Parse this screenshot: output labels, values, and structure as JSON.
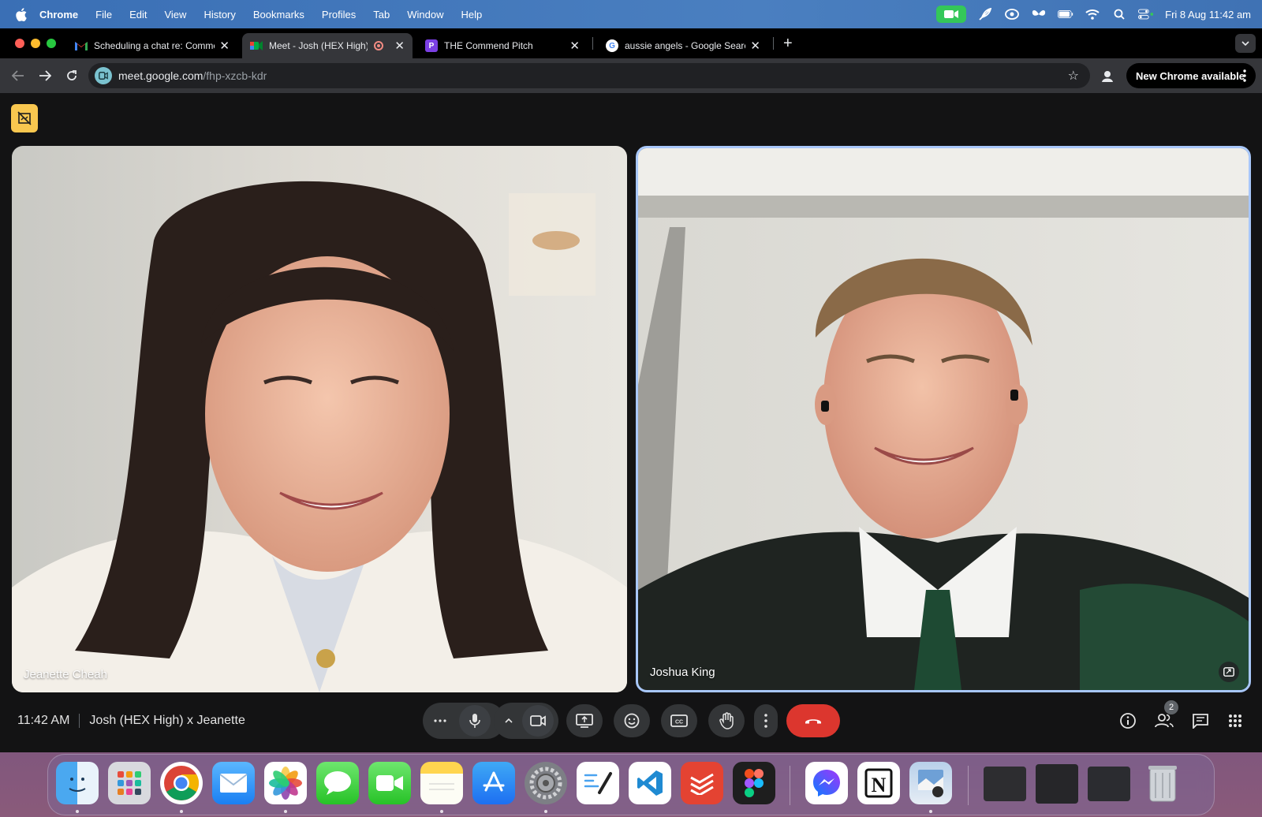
{
  "menubar": {
    "app_name": "Chrome",
    "items": [
      "File",
      "Edit",
      "View",
      "History",
      "Bookmarks",
      "Profiles",
      "Tab",
      "Window",
      "Help"
    ],
    "clock": "Fri 8 Aug  11:42 am"
  },
  "tabs": [
    {
      "title": "Scheduling a chat re: Comme",
      "icon": "gmail-icon",
      "active": false
    },
    {
      "title": "Meet - Josh (HEX High) x",
      "icon": "meet-icon",
      "active": true,
      "recording": true
    },
    {
      "title": "THE Commend Pitch",
      "icon": "doc-icon",
      "active": false
    },
    {
      "title": "aussie angels - Google Searc",
      "icon": "google-icon",
      "active": false
    }
  ],
  "toolbar": {
    "url_host": "meet.google.com",
    "url_path": "/fhp-xzcb-kdr",
    "update_label": "New Chrome available"
  },
  "meet": {
    "participants": [
      {
        "name": "Jeanette Cheah"
      },
      {
        "name": "Joshua King"
      }
    ],
    "time": "11:42 AM",
    "meeting_title": "Josh (HEX High) x Jeanette",
    "participant_count": "2",
    "colors": {
      "end_call": "#dc362e",
      "active_speaker_border": "#a8c7fa"
    }
  },
  "dock": {
    "apps": [
      "finder-icon",
      "launchpad-icon",
      "chrome-icon",
      "mail-icon",
      "photos-icon",
      "messages-icon",
      "facetime-icon",
      "notes-icon",
      "app-store-icon",
      "system-settings-icon",
      "freeform-icon",
      "vscode-icon",
      "todoist-icon",
      "figma-icon",
      "messenger-icon",
      "notion-icon",
      "preview-icon"
    ]
  }
}
